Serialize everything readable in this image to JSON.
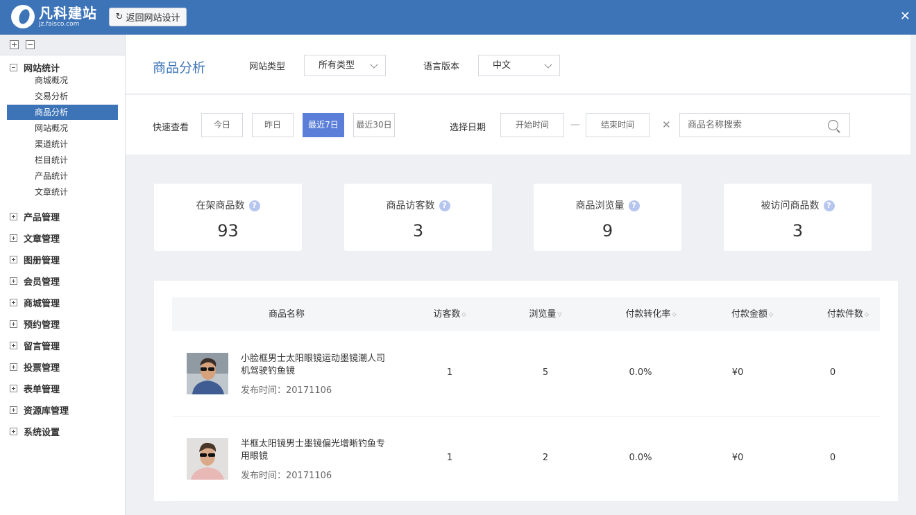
{
  "header": {
    "brand_name": "凡科建站",
    "brand_domain": "jz.faisco.com",
    "back_button_label": "返回网站设计"
  },
  "sidebar": {
    "groups": [
      {
        "label": "网站统计",
        "expanded": true
      },
      {
        "label": "产品管理"
      },
      {
        "label": "文章管理"
      },
      {
        "label": "图册管理"
      },
      {
        "label": "会员管理"
      },
      {
        "label": "商城管理"
      },
      {
        "label": "预约管理"
      },
      {
        "label": "留言管理"
      },
      {
        "label": "投票管理"
      },
      {
        "label": "表单管理"
      },
      {
        "label": "资源库管理"
      },
      {
        "label": "系统设置"
      }
    ],
    "stats_items": [
      {
        "label": "商城概况"
      },
      {
        "label": "交易分析"
      },
      {
        "label": "商品分析",
        "active": true
      },
      {
        "label": "网站概况"
      },
      {
        "label": "渠道统计"
      },
      {
        "label": "栏目统计"
      },
      {
        "label": "产品统计"
      },
      {
        "label": "文章统计"
      }
    ]
  },
  "page": {
    "title": "商品分析",
    "site_type_label": "网站类型",
    "site_type_value": "所有类型",
    "language_label": "语言版本",
    "language_value": "中文"
  },
  "filter": {
    "quick_label": "快速查看",
    "quick_buttons": [
      "今日",
      "昨日",
      "最近7日",
      "最近30日"
    ],
    "quick_active": "最近7日",
    "date_label": "选择日期",
    "start_placeholder": "开始时间",
    "end_placeholder": "结束时间",
    "search_placeholder": "商品名称搜索"
  },
  "stats": [
    {
      "label": "在架商品数",
      "value": "93"
    },
    {
      "label": "商品访客数",
      "value": "3"
    },
    {
      "label": "商品浏览量",
      "value": "9"
    },
    {
      "label": "被访问商品数",
      "value": "3"
    }
  ],
  "table": {
    "columns": [
      "商品名称",
      "访客数",
      "浏览量",
      "付款转化率",
      "付款金额",
      "付款件数"
    ],
    "rows": [
      {
        "name": "小脸框男士太阳眼镜运动墨镜潮人司机驾驶钓鱼镜",
        "date": "发布时间：20171106",
        "visitors": "1",
        "views": "5",
        "conversion": "0.0%",
        "amount": "¥0",
        "count": "0"
      },
      {
        "name": "半框太阳镜男士墨镜偏光增晰钓鱼专用眼镜",
        "date": "发布时间：20171106",
        "visitors": "1",
        "views": "2",
        "conversion": "0.0%",
        "amount": "¥0",
        "count": "0"
      }
    ]
  },
  "colors": {
    "brand": "#3d74b8",
    "accent": "#5b7fd8",
    "help_icon": "#b7c6ef"
  }
}
